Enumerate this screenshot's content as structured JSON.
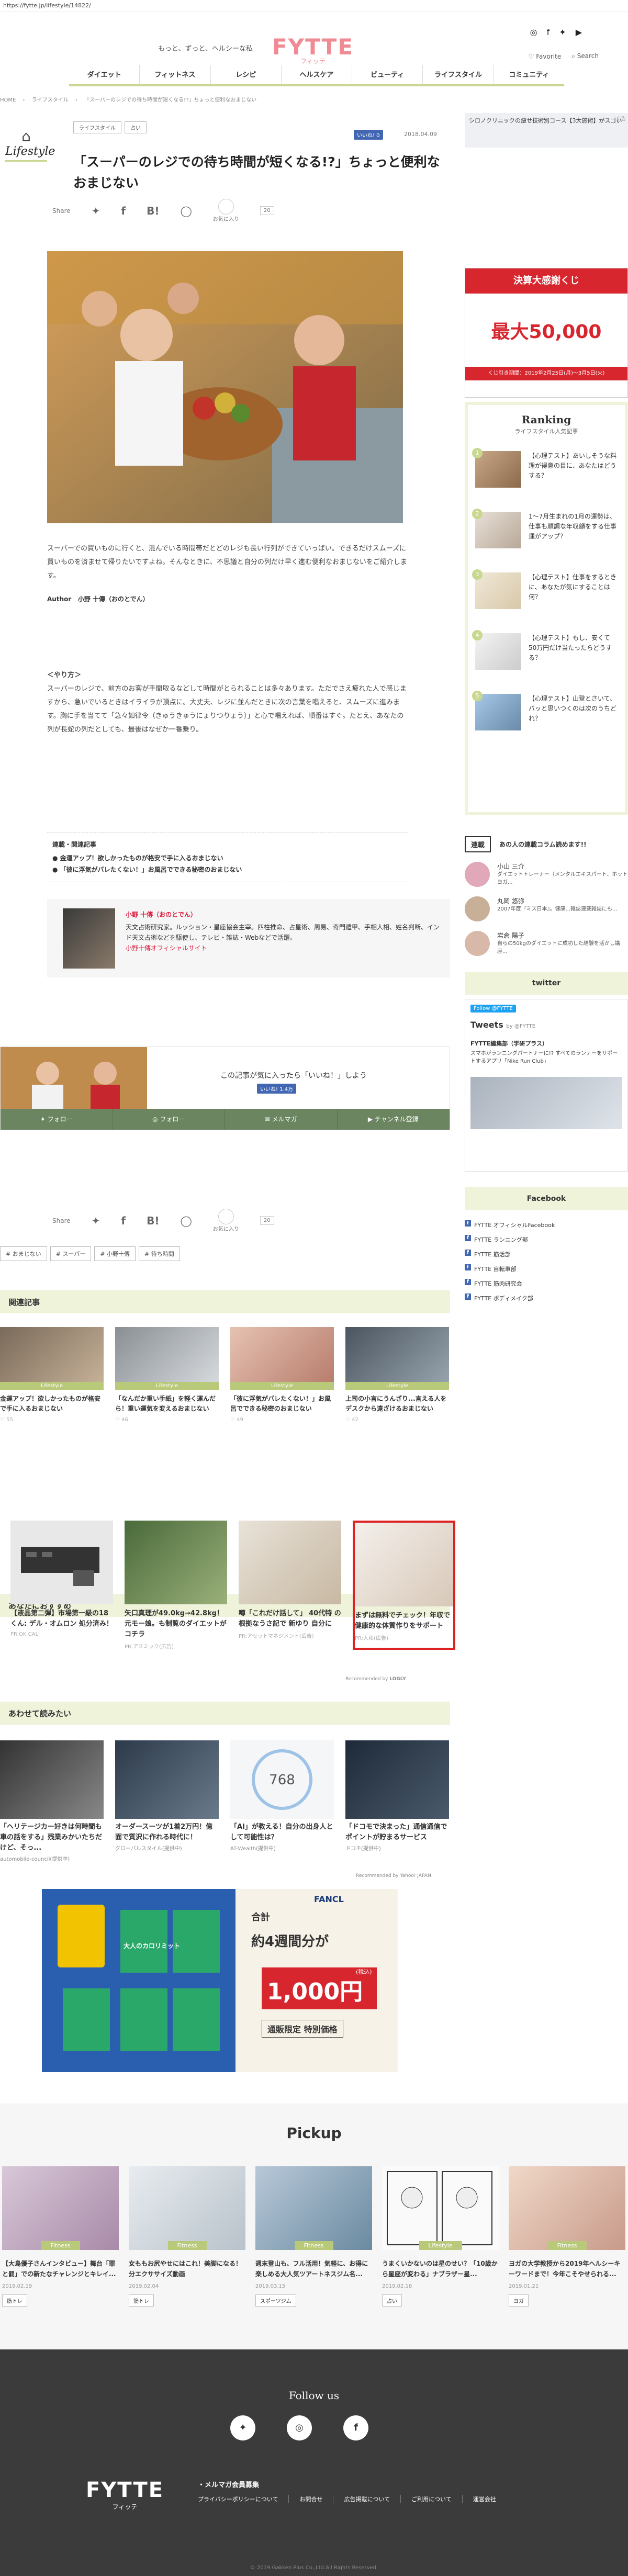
{
  "url": "https://fytte.jp/lifestyle/14822/",
  "header": {
    "tagline": "もっと、ずっと、ヘルシーな私",
    "logo": "FYTTE",
    "logo_sub": "フィッテ",
    "favorite": "Favorite",
    "search": "Search"
  },
  "nav": [
    "ダイエット",
    "フィットネス",
    "レシピ",
    "ヘルスケア",
    "ビューティ",
    "ライフスタイル",
    "コミュニティ"
  ],
  "breadcrumb": [
    "HOME",
    "ライフスタイル",
    "「スーパーのレジでの待ち時間が短くなる!?」ちょっと便利なおまじない"
  ],
  "article": {
    "category_name": "Lifestyle",
    "tags": [
      "ライフスタイル",
      "占い"
    ],
    "fb_like": "いいね! 0",
    "date": "2018.04.09",
    "title": "「スーパーのレジでの待ち時間が短くなる!?」ちょっと便利なおまじない",
    "share_label": "Share",
    "favorite_label": "お気に入り",
    "favorite_count": "20",
    "lead": "スーパーでの買いものに行くと、混んでいる時間帯だとどのレジも長い行列ができていっぱい。できるだけスムーズに買いものを済ませて帰りたいですよね。そんなときに、不思議と自分の列だけ早く進む便利なおまじないをご紹介します。",
    "author_label": "Author",
    "author_name": "小野 十傳（おのとでん）",
    "section_heading": "＜やり方＞",
    "body": "スーパーのレジで、前方のお客が手間取るなどして時間がとられることは多々あります。ただでさえ疲れた人で感じますから、急いでいるときはイライラが頂点に。大丈夫、レジに並んだときに次の言葉を唱えると、スムーズに進みます。胸に手を当てて「急々如律令（きゅうきゅうにょりつりょう）」と心で唱えれば、順番はすぐ。たとえ、あなたの列が長蛇の列だとしても、最後はなぜか一番乗り。",
    "related_heading": "連載・関連記事",
    "related_items": [
      "金運アップ！欲しかったものが格安で手に入るおまじない",
      "「彼に浮気がバレたくない！」お風呂でできる秘密のおまじない"
    ],
    "author_box_name": "小野 十傳（おのとでん）",
    "author_box_desc": "天文占術研究家。ルッション・星座協会主宰。四柱推命、占星術、周易、奇門遁甲、手相人相、姓名判断、インド天文占術などを駆使し、テレビ・雑誌・Webなどで活躍。",
    "author_box_link": "小野十傳オフィシャルサイト"
  },
  "like_band": {
    "message": "この記事が気に入ったら「いいね！」しよう",
    "like": "いいね! 1.4万",
    "follow": [
      "フォロー",
      "フォロー",
      "メルマガ",
      "チャンネル登録"
    ]
  },
  "keywords": [
    "おまじない",
    "スーパー",
    "小野十傳",
    "待ち時間"
  ],
  "sections": {
    "related": "関連記事",
    "recommend": "あなたにおすすめ",
    "also_read": "あわせて読みたい"
  },
  "related_cards": [
    {
      "title": "金運アップ！欲しかったものが格安で手に入るおまじない",
      "cat": "Lifestyle",
      "meta": "55"
    },
    {
      "title": "「なんだか重い手紙」を軽く運んだら！重い運気を変えるおまじない",
      "cat": "Lifestyle",
      "meta": "46"
    },
    {
      "title": "「彼に浮気がバレたくない！」お風呂でできる秘密のおまじない",
      "cat": "Lifestyle",
      "meta": "49"
    },
    {
      "title": "上司の小言にうんざり...言える人をデスクから遠ざけるおまじない",
      "cat": "Lifestyle",
      "meta": "42"
    }
  ],
  "recommend_cards": [
    {
      "title": "【液晶第二弾】市場第一級の18 くん: デル・オムロン 処分済み！",
      "meta": "PR:OK CALI"
    },
    {
      "title": "矢口真理が49.0kg→42.8kg！元モー娘。も制覧のダイエットがコチラ",
      "meta": "PR:アスミック(広告)"
    },
    {
      "title": "噂「これだけ話して」 40代特 の根拠なうさ記で 新ゆり 自分に",
      "meta": "PR:アセットマネジメント(広告)"
    },
    {
      "title": "まずは無料でチェック！年収で健康的な体質作りをサポート",
      "meta": "PR:大和(広告)"
    }
  ],
  "recommended_by": "Recommended by",
  "logly": "LOGLY",
  "also_read_cards": [
    {
      "title": "「ヘリテージカー好きは何時間も車の話をする」残業みかいたちだけど、そっ...",
      "meta": "automobile-council(提供中)",
      "counter": ""
    },
    {
      "title": "オーダースーツが1着2万円！億面で質沢に作れる時代に！",
      "meta": "グローバルスタイル(提供中)",
      "counter": ""
    },
    {
      "title": "「AI」が教える！自分の出身人として可能性は？",
      "meta": "AT-Wealth(提供中)",
      "counter": "768"
    },
    {
      "title": "「ドコモで決まった」通信通信でポイントが貯まるサービス",
      "meta": "ドコモ(提供中)",
      "counter": ""
    }
  ],
  "recommended_by_yahoo": "Recommended by Yahoo! JAPAN",
  "ad_banner": {
    "brand": "FANCL",
    "line1": "合計",
    "line2": "約4週間分が",
    "price": "1,000円",
    "tax": "(税込)",
    "note": "通販限定 特別価格",
    "product": "大人のカロリミット"
  },
  "pickup": {
    "title": "Pickup",
    "items": [
      {
        "title": "【大島優子さんインタビュー】舞台「罪と罰」での新たなチャレンジとキレイ...",
        "cat": "Fitness",
        "date": "2019.02.19",
        "tag": "筋トレ"
      },
      {
        "title": "女ももお尻やせにはこれ！美脚になる！分エクササイズ動画",
        "cat": "Fitness",
        "date": "2019.02.04",
        "tag": "筋トレ"
      },
      {
        "title": "週末登山も、フル活用！気軽に、お得に楽しめる大人気ツアートネスジム名...",
        "cat": "Fitness",
        "date": "2019.03.15",
        "tag": "スポーツジム"
      },
      {
        "title": "うまくいかないのは星のせい？「10歳から星座が変わる」ナブラザー星...",
        "cat": "Lifestyle",
        "date": "2019.02.18",
        "tag": "占い"
      },
      {
        "title": "ヨガの大学教授から2019年ヘルシーキーワードまで！今年こそやせられる...",
        "cat": "Fitness",
        "date": "2019.01.21",
        "tag": "ヨガ"
      }
    ]
  },
  "footer": {
    "follow_us": "Follow us",
    "logo": "FYTTE",
    "logo_sub": "フィッテ",
    "member": "・メルマガ会員募集",
    "links": [
      "プライバシーポリシーについて",
      "お問合せ",
      "広告掲載について",
      "ご利用について",
      "運営会社"
    ],
    "copyright": "© 2019 Gakken Plus Co.,Ltd.All Rights Reserved."
  },
  "sidebar": {
    "ad1_text": "シロノクリニックの痩せ技術別コース【3大施術】がスゴい",
    "ad1_label": "広告",
    "ad2_top": "決算大感謝くじ",
    "ad2_mid": "最大50,000",
    "ad2_bot": "くじ引き期間：2019年2月25日(月)〜3月5日(火)",
    "ranking_title": "Ranking",
    "ranking_sub": "ライフスタイル人気記事",
    "ranking": [
      {
        "num": "1",
        "title": "【心理テスト】あいしそうな料理が得意の目に、あなたはどうする？"
      },
      {
        "num": "2",
        "title": "1〜7月生まれの1月の運勢は、仕事も順調な年収額をする仕事運がアップ？"
      },
      {
        "num": "3",
        "title": "【心理テスト】仕事をするときに、あなたが気にすることは何？"
      },
      {
        "num": "4",
        "title": "【心理テスト】もし、安くて50万円だけ当たったらどうする？"
      },
      {
        "num": "5",
        "title": "【心理テスト】山登とさいて、バッと思いつくのは次のうちどれ？"
      }
    ],
    "rensai_label": "連載",
    "rensai_text": "あの人の連載コラム読めます!!",
    "columnists": [
      {
        "name": "小山 三介",
        "desc": "ダイエットトレーナー（メンタルエキスパート、ホットヨガ..."
      },
      {
        "name": "丸岡 悠弥",
        "desc": "2007年度『ミス日本』。健康...雑誌連載雑誌にも..."
      },
      {
        "name": "岩倉 陽子",
        "desc": "自らの50kgのダイエットに成功した経験を活かし講座..."
      }
    ],
    "twitter_head": "twitter",
    "tw_follow": "Follow @FYTTE",
    "tw_title": "Tweets",
    "tw_by": "by @FYTTE",
    "tw_who": "FYTTE編集部（学研プラス）",
    "tw_text": "スマホがランニングパートナーに!? すべてのランナーをサポートするアプリ「Nike Run Club」",
    "facebook_head": "Facebook",
    "fb_links": [
      "FYTTE オフィシャルFacebook",
      "FYTTE ランニング部",
      "FYTTE 筋活部",
      "FYTTE 自転車部",
      "FYTTE 筋肉研究会",
      "FYTTE ボディメイク部"
    ]
  },
  "colors": {
    "brand": "#f08a94",
    "accent": "#c9d88f",
    "follow_bar": "#6b8560"
  }
}
